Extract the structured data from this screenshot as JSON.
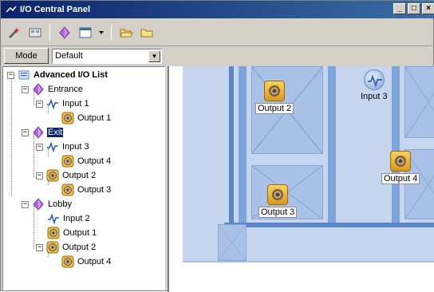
{
  "window": {
    "title": "I/O Central Panel",
    "controls": [
      "_",
      "□",
      "×"
    ]
  },
  "toolbar": {
    "buttons": [
      "wand-icon",
      "panel-icon",
      "diamond-icon",
      "window-icon",
      "dropdown-arrow-icon",
      "folder-open-icon",
      "folder-icon"
    ]
  },
  "mode": {
    "button_label": "Mode",
    "selected": "Default"
  },
  "tree": {
    "root": "Advanced I/O List",
    "items": [
      {
        "label": "Entrance"
      },
      {
        "label": "Input 1"
      },
      {
        "label": "Output 1"
      },
      {
        "label": "Exit"
      },
      {
        "label": "Input 3"
      },
      {
        "label": "Output 4"
      },
      {
        "label": "Output 2"
      },
      {
        "label": "Output 3"
      },
      {
        "label": "Lobby"
      },
      {
        "label": "Input 2"
      },
      {
        "label": "Output 1"
      },
      {
        "label": "Output 2"
      },
      {
        "label": "Output 4"
      }
    ]
  },
  "map": {
    "devices": [
      {
        "label": "Output 2"
      },
      {
        "label": "Input 3"
      },
      {
        "label": "Output 4"
      },
      {
        "label": "Output 3"
      }
    ]
  }
}
